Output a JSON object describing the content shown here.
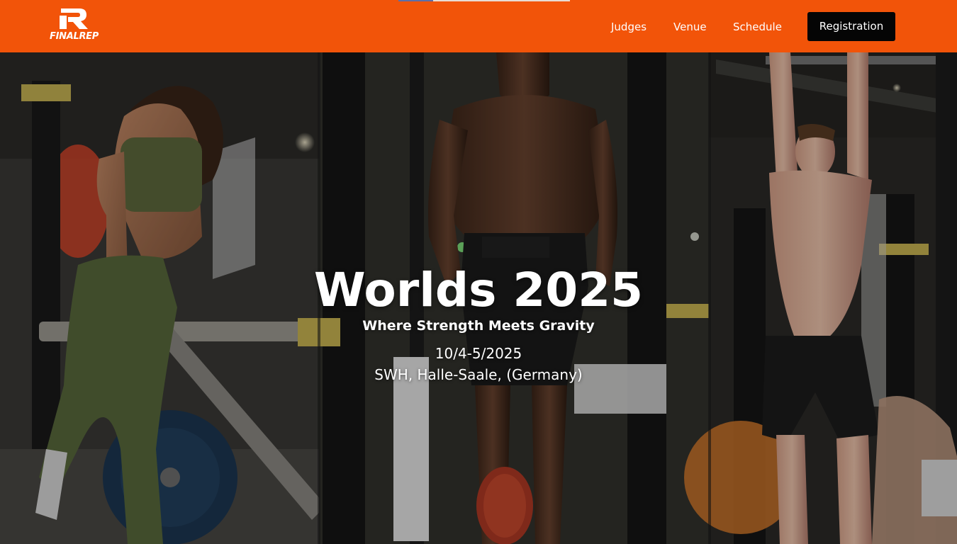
{
  "header": {
    "brand": {
      "logo_icon": "finalrep-r-logo-icon",
      "logo_text": "FINALREP"
    },
    "nav": [
      {
        "label": "Judges"
      },
      {
        "label": "Venue"
      },
      {
        "label": "Schedule"
      }
    ],
    "cta_label": "Registration",
    "colors": {
      "header_bg": "#f25409",
      "cta_bg": "#050505",
      "text": "#ffffff"
    }
  },
  "hero": {
    "title": "Worlds 2025",
    "subtitle": "Where Strength Meets Gravity",
    "date": "10/4-5/2025",
    "location": "SWH, Halle-Saale, (Germany)",
    "background": "photo-collage-of-three-weighted-calisthenics-athletes"
  }
}
